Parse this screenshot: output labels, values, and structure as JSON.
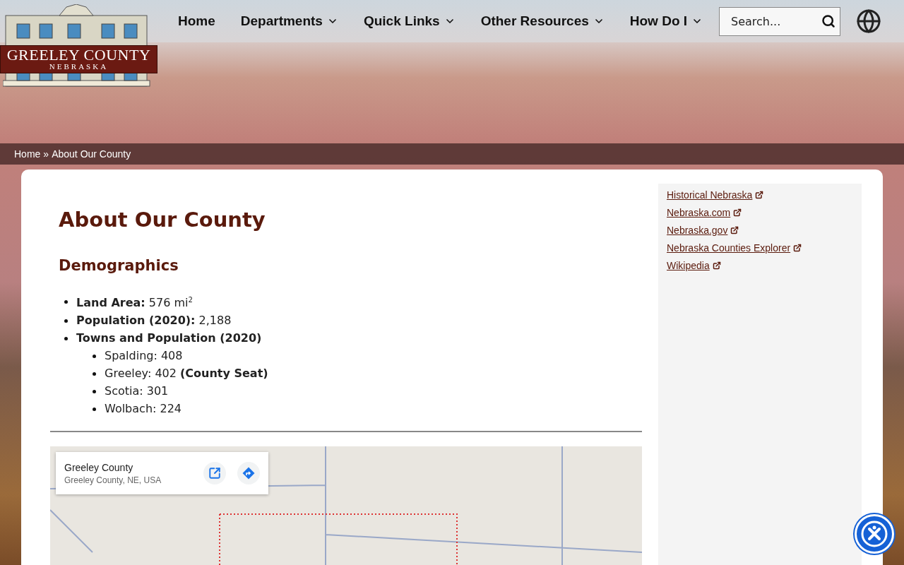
{
  "logo": {
    "title": "GREELEY COUNTY",
    "subtitle": "NEBRASKA"
  },
  "nav": [
    {
      "label": "Home",
      "has_menu": false
    },
    {
      "label": "Departments",
      "has_menu": true
    },
    {
      "label": "Quick Links",
      "has_menu": true
    },
    {
      "label": "Other Resources",
      "has_menu": true
    },
    {
      "label": "How Do I",
      "has_menu": true
    }
  ],
  "search": {
    "placeholder": "Search..."
  },
  "breadcrumb": {
    "home": "Home",
    "separator": "»",
    "current": "About Our County"
  },
  "page_title": "About Our County",
  "section_title": "Demographics",
  "facts": [
    {
      "label": "Land Area:",
      "value": "576 mi$^{2}$"
    },
    {
      "label": "Population (2020):",
      "value": "2,188"
    },
    {
      "label": "Towns and Population (2020)",
      "children": [
        {
          "text": "Spalding: 408"
        },
        {
          "text": "Greeley: 402 **(County Seat)**"
        },
        {
          "text": "Scotia: 301"
        },
        {
          "text": "Wolbach: 224"
        }
      ]
    }
  ],
  "map_card": {
    "title": "Greeley County",
    "address": "Greeley County, NE, USA"
  },
  "sidebar_links": [
    "Historical Nebraska",
    "Nebraska.com",
    "Nebraska.gov",
    "Nebraska Counties Explorer",
    "Wikipedia"
  ]
}
